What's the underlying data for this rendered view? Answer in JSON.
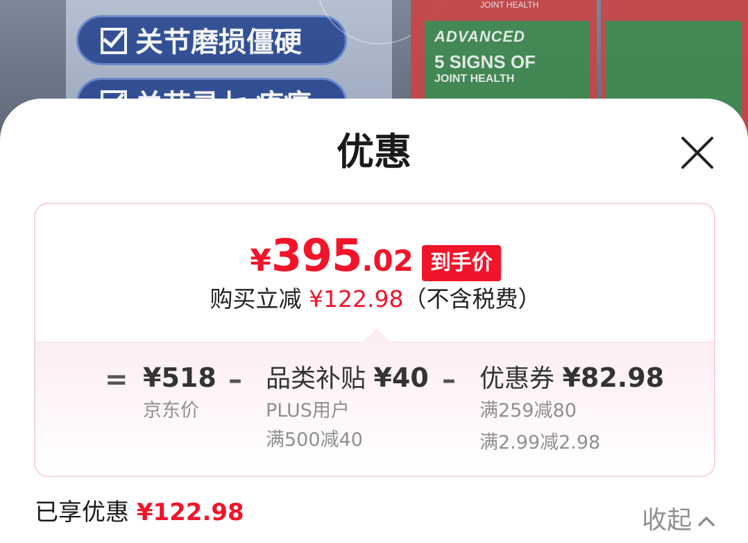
{
  "backdrop": {
    "tag_1": "关节磨损僵硬",
    "tag_2": "关节灵七 疼痛",
    "bottle_badge": "ADVANCED",
    "bottle_line_1": "5 SIGNS OF",
    "bottle_line_2": "JOINT HEALTH",
    "bottle_top": "JOINT HEALTH"
  },
  "sheet": {
    "title": "优惠",
    "close_icon": "close-icon"
  },
  "summary": {
    "price_symbol": "¥",
    "price_integer": "395",
    "price_decimal": ".02",
    "price_badge": "到手价",
    "saving_prefix": "购买立减",
    "saving_amount": "¥122.98",
    "saving_suffix": "（不含税费）"
  },
  "breakdown": {
    "equals": "=",
    "minus": "–",
    "jd_price": {
      "amount": "¥518",
      "label": "京东价"
    },
    "subsidy": {
      "label": "品类补贴",
      "amount": "¥40",
      "condition_1": "PLUS用户",
      "condition_2": "满500减40"
    },
    "coupon": {
      "label": "优惠券",
      "amount": "¥82.98",
      "condition_1": "满259减80",
      "condition_2": "满2.99减2.98"
    }
  },
  "footer": {
    "enjoyed_label": "已享优惠",
    "enjoyed_amount": "¥122.98",
    "collapse_label": "收起",
    "collapse_icon": "chevron-up-icon"
  },
  "colors": {
    "accent_red": "#f2142a",
    "card_border": "#f7d3db",
    "muted_text": "#8f8f8f"
  }
}
